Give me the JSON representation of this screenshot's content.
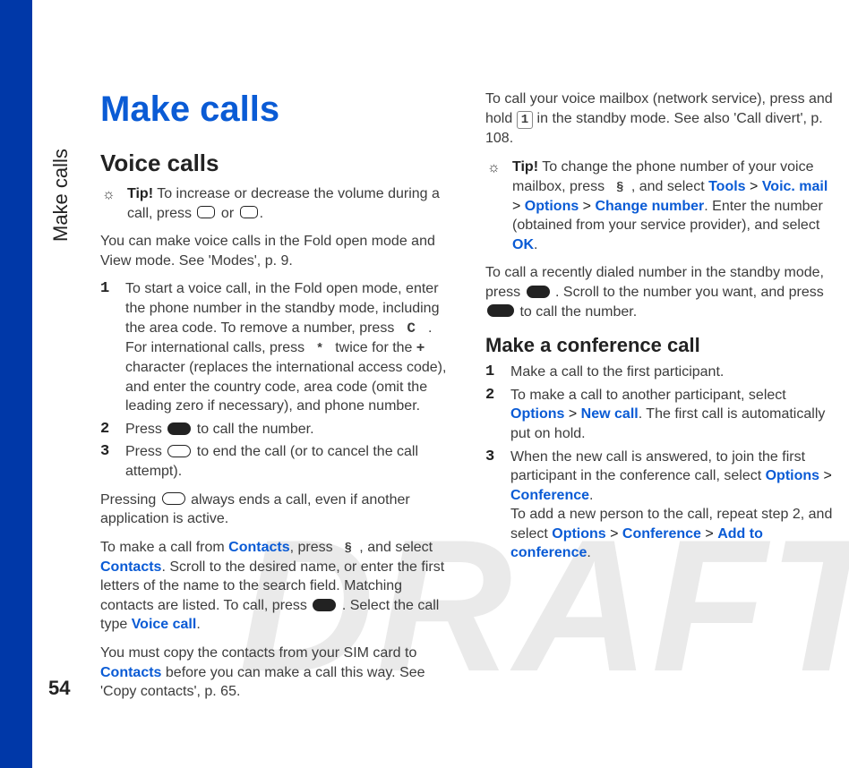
{
  "watermark": "DRAFT",
  "side_label": "Make calls",
  "page_number": "54",
  "title": "Make calls",
  "section_voice": "Voice calls",
  "tip1_label": "Tip!",
  "tip1_a": " To increase or decrease the volume during a call, press ",
  "tip1_b": " or ",
  "tip1_c": ".",
  "p1": "You can make voice calls in the Fold open mode and View mode. See 'Modes', p. 9.",
  "list1": {
    "i1": {
      "num": "1",
      "a": "To start a voice call, in the Fold open mode, enter the phone number in the standby mode, including the area code. To remove a number, press ",
      "b": " .",
      "c": "For international calls, press ",
      "d": " twice for the ",
      "plus": "+",
      "e": " character (replaces the international access code), and enter the country code, area code (omit the leading zero if necessary), and phone number."
    },
    "i2": {
      "num": "2",
      "a": "Press ",
      "b": " to call the number."
    },
    "i3": {
      "num": "3",
      "a": "Press ",
      "b": " to end the call (or to cancel the call attempt)."
    }
  },
  "p2a": "Pressing ",
  "p2b": " always ends a call, even if another application is active.",
  "p3": {
    "a": "To make a call from ",
    "contacts": "Contacts",
    "b": ", press ",
    "c": ", and select ",
    "contacts2": "Contacts",
    "d": ". Scroll to the desired name, or enter the first letters of the name to the search field. Matching contacts are listed. To call, press ",
    "e": " . Select the call type ",
    "voicecall": "Voice call",
    "f": "."
  },
  "p4": {
    "a": "You must copy the contacts from your SIM card to ",
    "contacts": "Contacts",
    "b": " before you can make a call this way. See 'Copy contacts', p. 65."
  },
  "p5": {
    "a": "To call your voice mailbox (network service), press and hold ",
    "one": "1",
    "b": " in the standby mode. See also 'Call divert', p. 108."
  },
  "tip2_label": "Tip!",
  "tip2": {
    "a": " To change the phone number of your voice mailbox, press ",
    "b": ", and select ",
    "tools": "Tools",
    "gt1": " > ",
    "voicmail": "Voic. mail",
    "gt2": " > ",
    "options": "Options",
    "gt3": " > ",
    "change": "Change number",
    "c": ". Enter the number (obtained from your service provider), and select ",
    "ok": "OK",
    "d": "."
  },
  "p6": {
    "a": "To call a recently dialed number in the standby mode, press ",
    "b": " . Scroll to the number you want, and press ",
    "c": " to call the number."
  },
  "subsection_conf": "Make a conference call",
  "list2": {
    "i1": {
      "num": "1",
      "a": "Make a call to the first participant."
    },
    "i2": {
      "num": "2",
      "a": "To make a call to another participant, select ",
      "options": "Options",
      "gt": " > ",
      "newcall": "New call",
      "b": ". The first call is automatically put on hold."
    },
    "i3": {
      "num": "3",
      "a": "When the new call is answered, to join the first participant in the conference call, select ",
      "options": "Options",
      "gt": " > ",
      "conference": "Conference",
      "b": ".",
      "c": "To add a new person to the call, repeat step 2, and select ",
      "options2": "Options",
      "gt2": " > ",
      "conference2": "Conference",
      "gt3": " > ",
      "add": "Add to conference",
      "d": "."
    }
  }
}
